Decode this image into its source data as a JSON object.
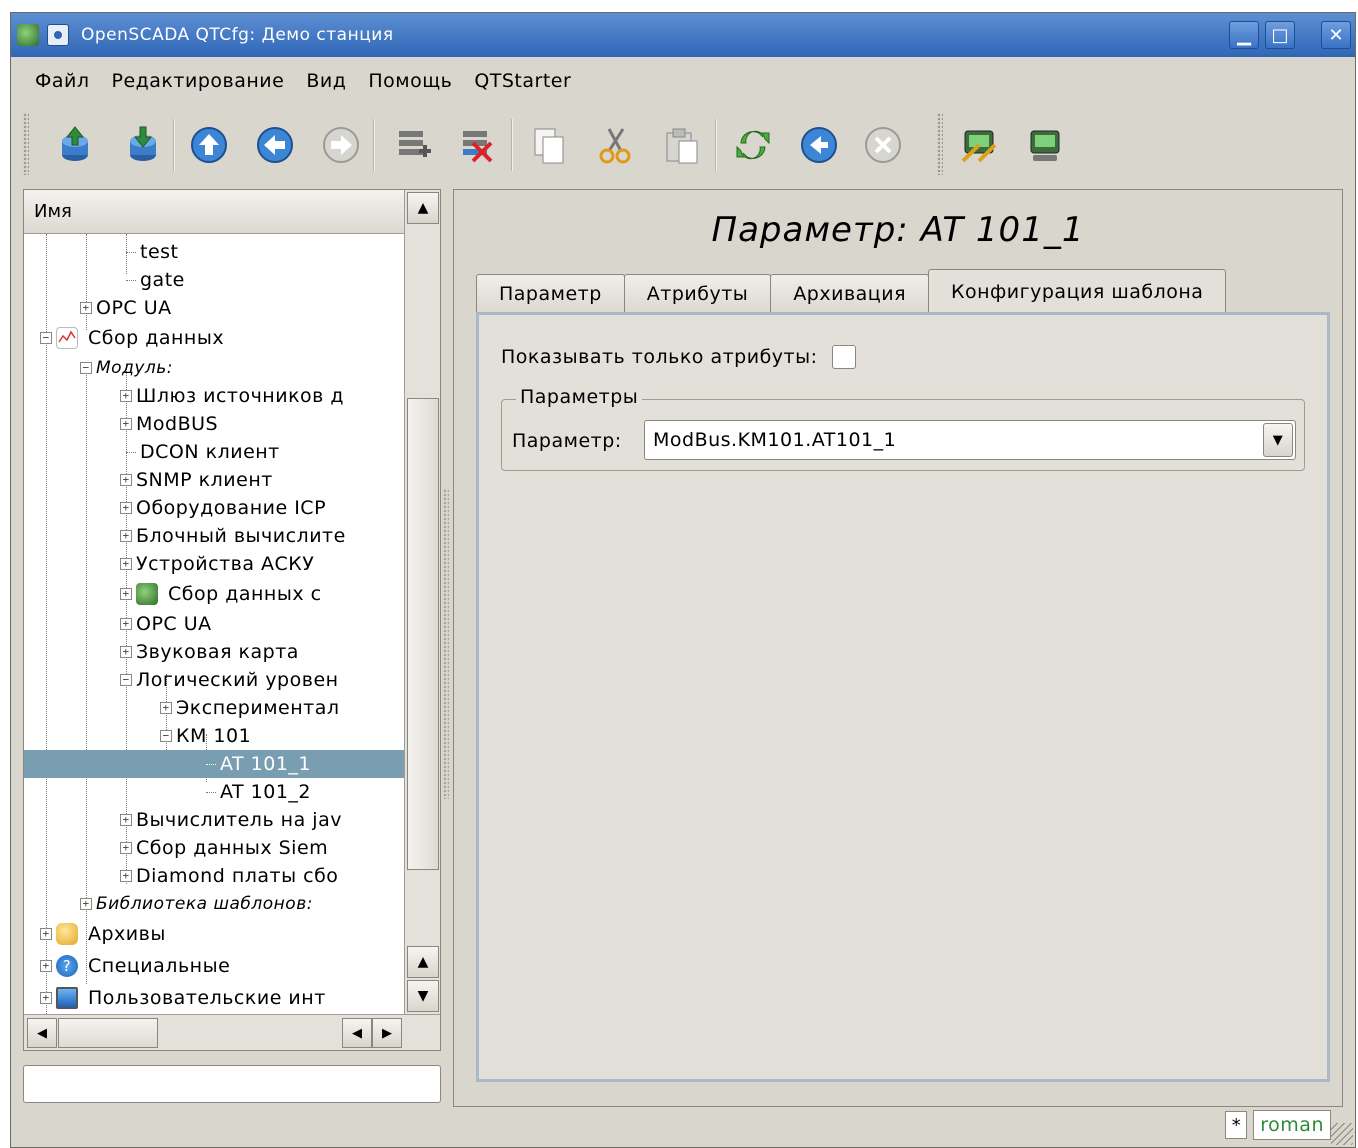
{
  "window": {
    "title": "OpenSCADA QTCfg: Демо станция",
    "buttons": {
      "minimize": "▁",
      "maximize": "□",
      "close": "✕"
    }
  },
  "menu": [
    "Файл",
    "Редактирование",
    "Вид",
    "Помощь",
    "QTStarter"
  ],
  "toolbar": {
    "icons": [
      "db-load-icon",
      "db-save-icon",
      "up-icon",
      "back-icon",
      "forward-icon",
      "add-item-icon",
      "delete-item-icon",
      "copy-icon",
      "cut-icon",
      "paste-icon",
      "refresh-icon",
      "start-icon",
      "stop-icon",
      "starter-config-icon",
      "starter-run-icon"
    ]
  },
  "tree": {
    "header": "Имя",
    "items": [
      {
        "label": "test"
      },
      {
        "label": "gate"
      },
      {
        "label": "OPC UA"
      },
      {
        "label": "Сбор данных"
      },
      {
        "label": "Модуль:"
      },
      {
        "label": "Шлюз источников д"
      },
      {
        "label": "ModBUS"
      },
      {
        "label": "DCON клиент"
      },
      {
        "label": "SNMP клиент"
      },
      {
        "label": "Оборудование ICP"
      },
      {
        "label": "Блочный вычислите"
      },
      {
        "label": "Устройства АСКУ"
      },
      {
        "label": "Сбор данных с"
      },
      {
        "label": "OPC UA"
      },
      {
        "label": "Звуковая карта"
      },
      {
        "label": "Логический уровен"
      },
      {
        "label": "Экспериментал"
      },
      {
        "label": "КМ 101"
      },
      {
        "label": "AT 101_1"
      },
      {
        "label": "AT 101_2"
      },
      {
        "label": "Вычислитель на jav"
      },
      {
        "label": "Сбор данных Siem"
      },
      {
        "label": "Diamond платы сбо"
      },
      {
        "label": "Библиотека шаблонов:"
      },
      {
        "label": "Архивы"
      },
      {
        "label": "Специальные"
      },
      {
        "label": "Пользовательские инт"
      }
    ]
  },
  "page": {
    "title": "Параметр: AT 101_1",
    "tabs": [
      "Параметр",
      "Атрибуты",
      "Архивация",
      "Конфигурация шаблона"
    ],
    "active_tab": "Конфигурация шаблона",
    "show_only_attrs_label": "Показывать только атрибуты:",
    "group_title": "Параметры",
    "param_label": "Параметр:",
    "param_value": "ModBus.KM101.AT101_1"
  },
  "statusbar": {
    "modified": "*",
    "user": "roman"
  }
}
